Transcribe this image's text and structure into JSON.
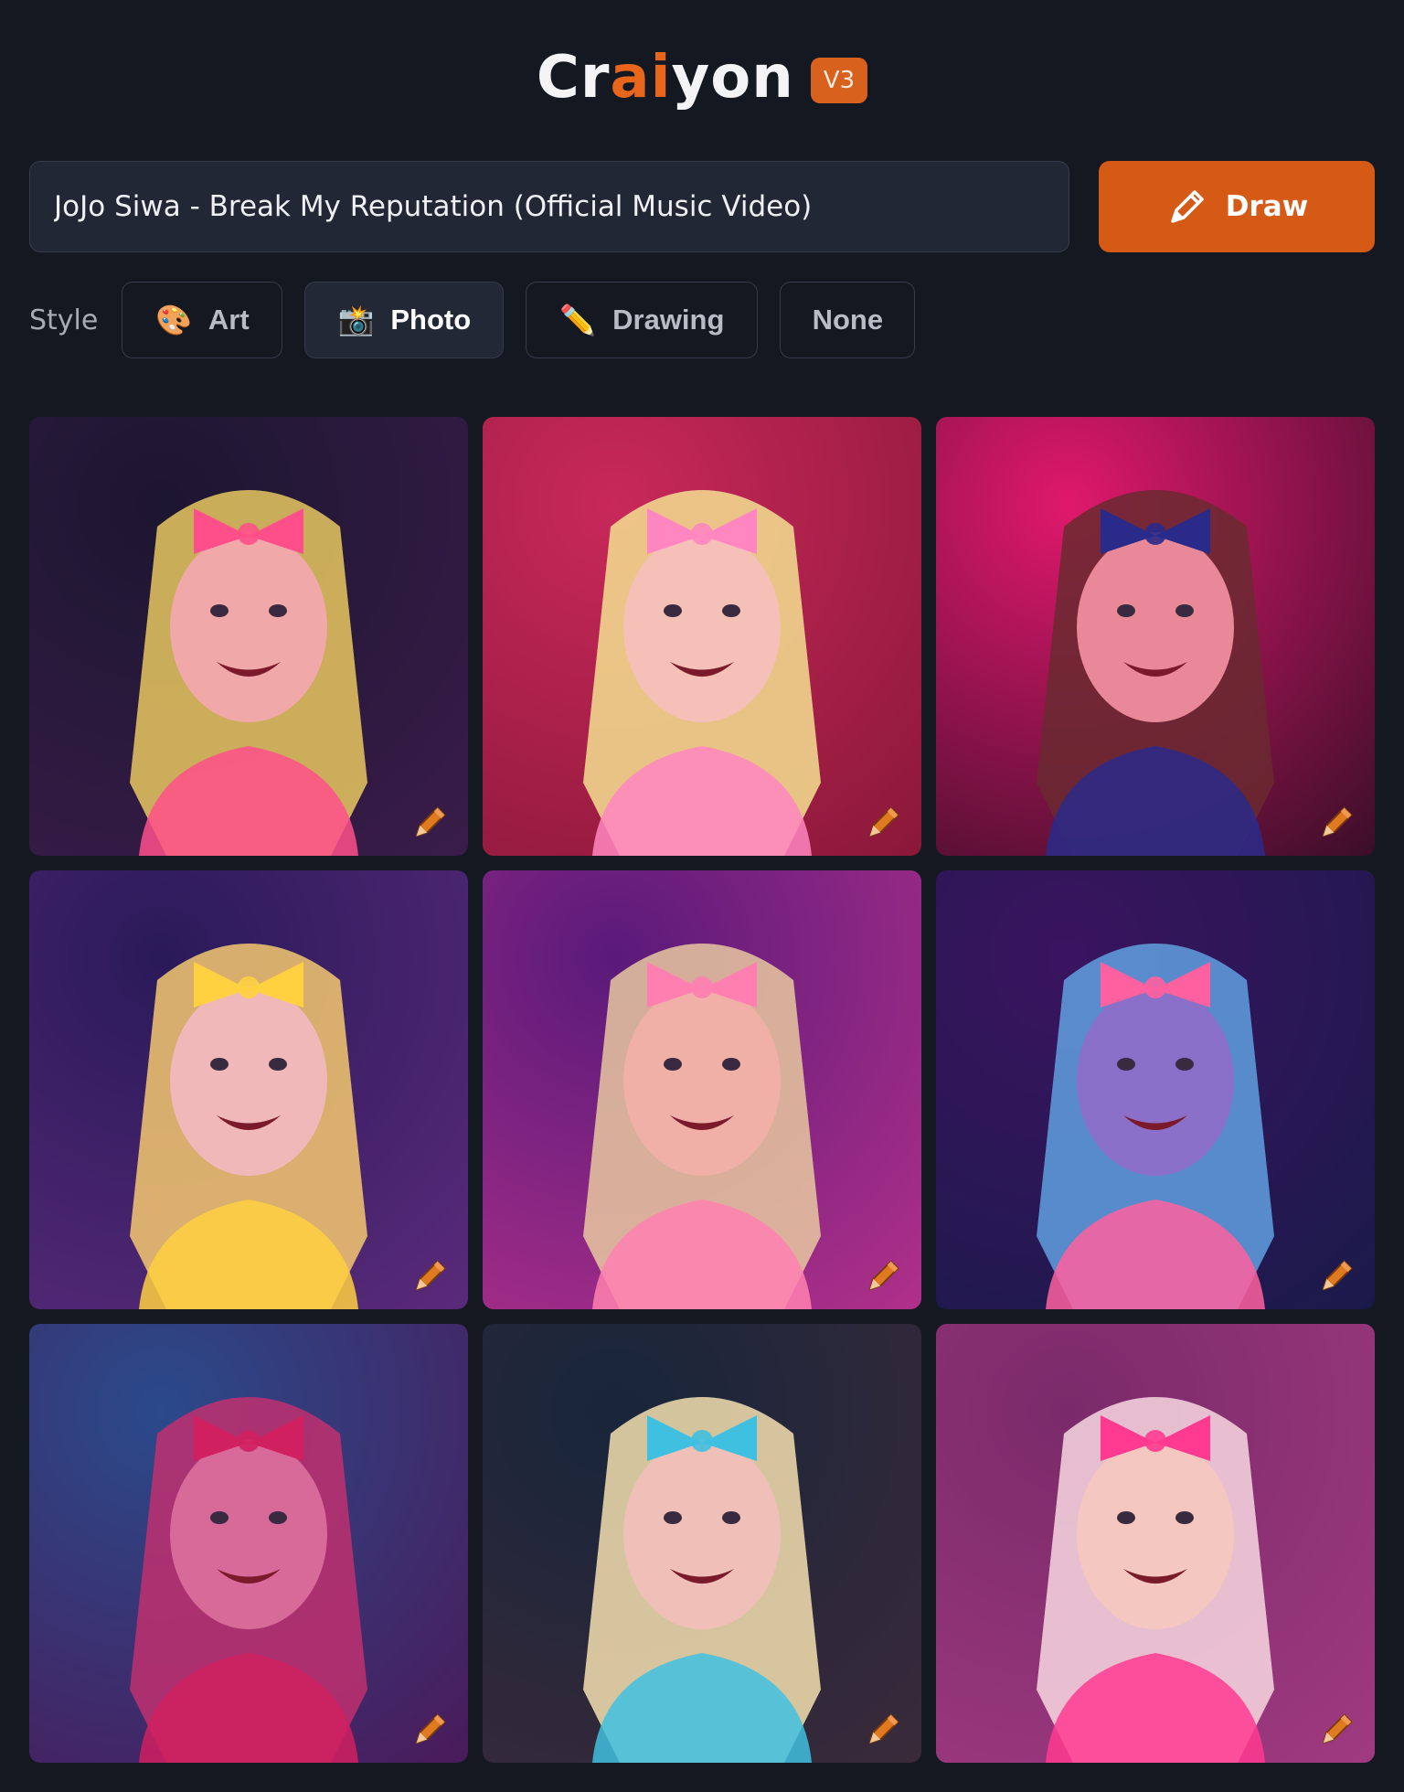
{
  "brand": {
    "name_prefix": "Cr",
    "name_accent": "ai",
    "name_suffix": "yon",
    "version": "V3"
  },
  "search": {
    "value": "JoJo Siwa - Break My Reputation (Official Music Video)"
  },
  "draw_button": {
    "label": "Draw",
    "icon": "pencil-icon"
  },
  "styles": {
    "label": "Style",
    "options": [
      {
        "label": "Art",
        "emoji": "🎨",
        "active": false
      },
      {
        "label": "Photo",
        "emoji": "📸",
        "active": true
      },
      {
        "label": "Drawing",
        "emoji": "✏️",
        "active": false
      },
      {
        "label": "None",
        "emoji": "",
        "active": false
      }
    ]
  },
  "gallery": {
    "tiles": [
      {
        "bg": [
          "#1c1630",
          "#3a1c4a"
        ],
        "hair": "#e8c860",
        "accent": "#ff4f8a",
        "face": "#f0a8a8"
      },
      {
        "bg": [
          "#c8285a",
          "#8a1838"
        ],
        "hair": "#f4e090",
        "accent": "#ff86c0",
        "face": "#f4c0b8"
      },
      {
        "bg": [
          "#e0186c",
          "#3a0e28"
        ],
        "hair": "#6a2a30",
        "accent": "#2a2a8a",
        "face": "#e88898"
      },
      {
        "bg": [
          "#2a1a5a",
          "#5a2a7a"
        ],
        "hair": "#f4c870",
        "accent": "#ffd040",
        "face": "#f0b8b8"
      },
      {
        "bg": [
          "#5a1a7a",
          "#b0308a"
        ],
        "hair": "#e8c8a0",
        "accent": "#ff80b0",
        "face": "#f0b0a8"
      },
      {
        "bg": [
          "#3a1460",
          "#1a1a4a"
        ],
        "hair": "#60a0e0",
        "accent": "#ff60a0",
        "face": "#8a70c8"
      },
      {
        "bg": [
          "#2a4a8a",
          "#4a1a5a"
        ],
        "hair": "#c03070",
        "accent": "#d02060",
        "face": "#d86a9a"
      },
      {
        "bg": [
          "#18253a",
          "#3a2a3a"
        ],
        "hair": "#f4e0b0",
        "accent": "#40c0e0",
        "face": "#f0c0b8"
      },
      {
        "bg": [
          "#7a2a6a",
          "#a03a80"
        ],
        "hair": "#f8d8e0",
        "accent": "#ff3a90",
        "face": "#f4c8c0"
      }
    ]
  }
}
